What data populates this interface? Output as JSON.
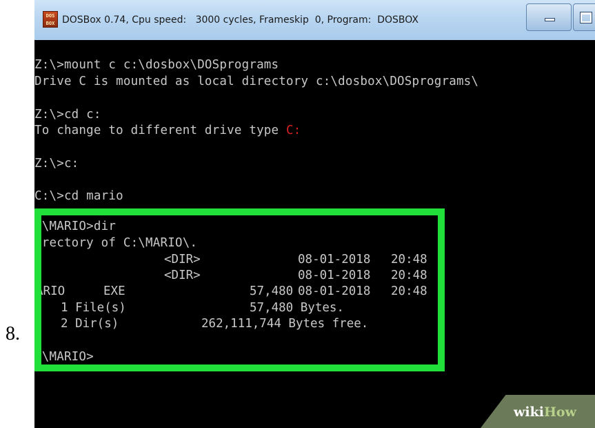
{
  "step": {
    "number": "8."
  },
  "window": {
    "app_icon_label": "DOS BOX",
    "title": "DOSBox 0.74, Cpu speed:   3000 cycles, Frameskip  0, Program:  DOSBOX"
  },
  "console": {
    "lines": [
      "Z:\\>mount c c:\\dosbox\\DOSprograms",
      "Drive C is mounted as local directory c:\\dosbox\\DOSprograms\\",
      "Z:\\>cd c:",
      "To change to different drive type ",
      "Z:\\>c:",
      "C:\\>cd mario"
    ],
    "drive_hint": "C:",
    "listing": {
      "prompt_dir": ":\\MARIO>dir",
      "directory_of": "irectory of C:\\MARIO\\.",
      "rows": [
        {
          "name": ".",
          "ext": "",
          "dir": "<DIR>",
          "size": "",
          "date": "08-01-2018",
          "time": "20:48"
        },
        {
          "name": ".",
          "ext": "",
          "dir": "<DIR>",
          "size": "",
          "date": "08-01-2018",
          "time": "20:48"
        },
        {
          "name": "ARIO",
          "ext": "EXE",
          "dir": "",
          "size": "57,480",
          "date": "08-01-2018",
          "time": "20:48"
        }
      ],
      "files_count": "1 File(s)",
      "files_bytes": "57,480 Bytes.",
      "dirs_count": "2 Dir(s)",
      "dirs_bytes": "262,111,744 Bytes free.",
      "final_prompt": ":\\MARIO>"
    }
  },
  "watermark": {
    "wiki": "wiki",
    "how": "How"
  },
  "colors": {
    "highlight": "#22e03a",
    "console_text": "#c8c8c8",
    "console_bg": "#000000",
    "drive_hint": "#d82020"
  }
}
